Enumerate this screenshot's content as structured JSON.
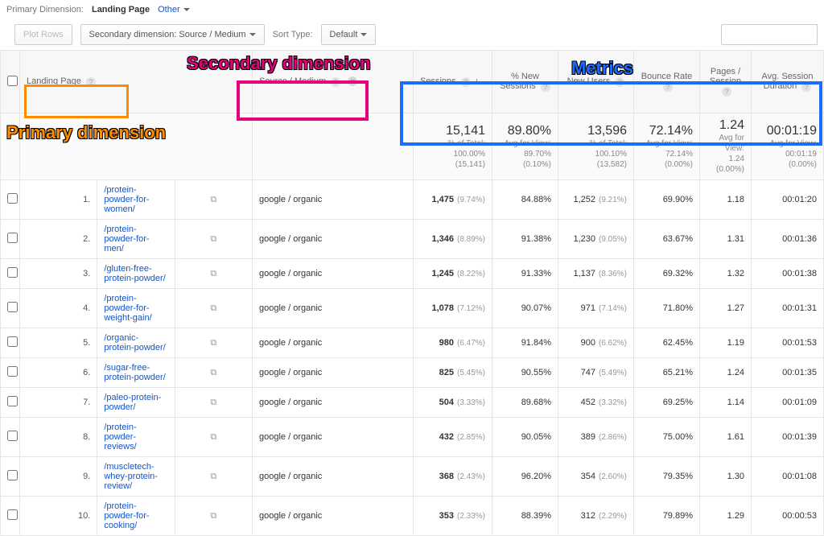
{
  "toolbar": {
    "primary_dimension_label": "Primary Dimension:",
    "primary_dimension_value": "Landing Page",
    "other_link": "Other",
    "plot_rows": "Plot Rows",
    "secondary_dimension": "Secondary dimension: Source / Medium",
    "sort_type_label": "Sort Type:",
    "sort_type_value": "Default"
  },
  "headers": {
    "landing_page": "Landing Page",
    "source_medium": "Source / Medium",
    "sessions": "Sessions",
    "pct_new_sessions": "% New Sessions",
    "new_users": "New Users",
    "bounce_rate": "Bounce Rate",
    "pages_session": "Pages / Session",
    "avg_duration": "Avg. Session Duration"
  },
  "summary": {
    "sessions": {
      "big": "15,141",
      "l1": "% of Total:",
      "l2": "100.00%",
      "l3": "(15,141)"
    },
    "pct_new": {
      "big": "89.80%",
      "l1": "Avg for View:",
      "l2": "89.70%",
      "l3": "(0.10%)"
    },
    "new_users": {
      "big": "13,596",
      "l1": "% of Total:",
      "l2": "100.10%",
      "l3": "(13,582)"
    },
    "bounce": {
      "big": "72.14%",
      "l1": "Avg for View:",
      "l2": "72.14%",
      "l3": "(0.00%)"
    },
    "pages": {
      "big": "1.24",
      "l1": "Avg for View:",
      "l2": "1.24",
      "l3": "(0.00%)"
    },
    "duration": {
      "big": "00:01:19",
      "l1": "Avg for View:",
      "l2": "00:01:19",
      "l3": "(0.00%)"
    }
  },
  "rows": [
    {
      "idx": "1.",
      "lp": "/protein-powder-for-women/",
      "src": "google / organic",
      "sessions": "1,475",
      "sessions_pct": "(9.74%)",
      "pct_new": "84.88%",
      "new_users": "1,252",
      "new_users_pct": "(9.21%)",
      "bounce": "69.90%",
      "pages": "1.18",
      "duration": "00:01:20"
    },
    {
      "idx": "2.",
      "lp": "/protein-powder-for-men/",
      "src": "google / organic",
      "sessions": "1,346",
      "sessions_pct": "(8.89%)",
      "pct_new": "91.38%",
      "new_users": "1,230",
      "new_users_pct": "(9.05%)",
      "bounce": "63.67%",
      "pages": "1.31",
      "duration": "00:01:36"
    },
    {
      "idx": "3.",
      "lp": "/gluten-free-protein-powder/",
      "src": "google / organic",
      "sessions": "1,245",
      "sessions_pct": "(8.22%)",
      "pct_new": "91.33%",
      "new_users": "1,137",
      "new_users_pct": "(8.36%)",
      "bounce": "69.32%",
      "pages": "1.32",
      "duration": "00:01:38"
    },
    {
      "idx": "4.",
      "lp": "/protein-powder-for-weight-gain/",
      "src": "google / organic",
      "sessions": "1,078",
      "sessions_pct": "(7.12%)",
      "pct_new": "90.07%",
      "new_users": "971",
      "new_users_pct": "(7.14%)",
      "bounce": "71.80%",
      "pages": "1.27",
      "duration": "00:01:31"
    },
    {
      "idx": "5.",
      "lp": "/organic-protein-powder/",
      "src": "google / organic",
      "sessions": "980",
      "sessions_pct": "(6.47%)",
      "pct_new": "91.84%",
      "new_users": "900",
      "new_users_pct": "(6.62%)",
      "bounce": "62.45%",
      "pages": "1.19",
      "duration": "00:01:53"
    },
    {
      "idx": "6.",
      "lp": "/sugar-free-protein-powder/",
      "src": "google / organic",
      "sessions": "825",
      "sessions_pct": "(5.45%)",
      "pct_new": "90.55%",
      "new_users": "747",
      "new_users_pct": "(5.49%)",
      "bounce": "65.21%",
      "pages": "1.24",
      "duration": "00:01:35"
    },
    {
      "idx": "7.",
      "lp": "/paleo-protein-powder/",
      "src": "google / organic",
      "sessions": "504",
      "sessions_pct": "(3.33%)",
      "pct_new": "89.68%",
      "new_users": "452",
      "new_users_pct": "(3.32%)",
      "bounce": "69.25%",
      "pages": "1.14",
      "duration": "00:01:09"
    },
    {
      "idx": "8.",
      "lp": "/protein-powder-reviews/",
      "src": "google / organic",
      "sessions": "432",
      "sessions_pct": "(2.85%)",
      "pct_new": "90.05%",
      "new_users": "389",
      "new_users_pct": "(2.86%)",
      "bounce": "75.00%",
      "pages": "1.61",
      "duration": "00:01:39"
    },
    {
      "idx": "9.",
      "lp": "/muscletech-whey-protein-review/",
      "src": "google / organic",
      "sessions": "368",
      "sessions_pct": "(2.43%)",
      "pct_new": "96.20%",
      "new_users": "354",
      "new_users_pct": "(2.60%)",
      "bounce": "79.35%",
      "pages": "1.30",
      "duration": "00:01:08"
    },
    {
      "idx": "10.",
      "lp": "/protein-powder-for-cooking/",
      "src": "google / organic",
      "sessions": "353",
      "sessions_pct": "(2.33%)",
      "pct_new": "88.39%",
      "new_users": "312",
      "new_users_pct": "(2.29%)",
      "bounce": "79.89%",
      "pages": "1.29",
      "duration": "00:00:53"
    }
  ],
  "annotations": {
    "primary": "Primary dimension",
    "secondary": "Secondary dimension",
    "metrics": "Metrics"
  }
}
